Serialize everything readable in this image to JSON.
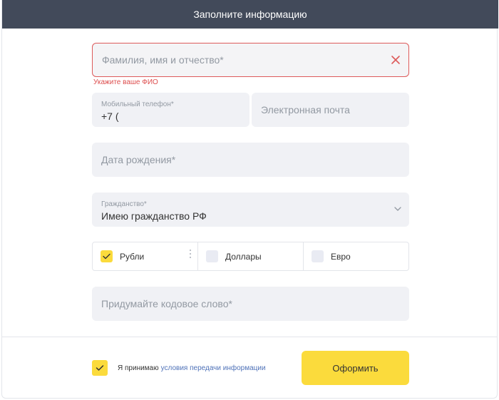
{
  "header": {
    "title": "Заполните информацию"
  },
  "fio": {
    "placeholder": "Фамилия, имя и отчество*",
    "error": "Укажите ваше ФИО"
  },
  "phone": {
    "label": "Мобильный телефон*",
    "value": "+7 ("
  },
  "email": {
    "placeholder": "Электронная почта"
  },
  "birthdate": {
    "placeholder": "Дата рождения*"
  },
  "citizenship": {
    "label": "Гражданство*",
    "value": "Имею гражданство РФ"
  },
  "currencies": [
    {
      "label": "Рубли",
      "checked": true
    },
    {
      "label": "Доллары",
      "checked": false
    },
    {
      "label": "Евро",
      "checked": false
    }
  ],
  "codeword": {
    "placeholder": "Придумайте кодовое слово*"
  },
  "consent": {
    "text": "Я принимаю",
    "link": "условия передачи информации",
    "checked": true
  },
  "submit": {
    "label": "Оформить"
  },
  "colors": {
    "header_bg": "#424a5a",
    "accent": "#fbdb3c",
    "error": "#dd4d4d",
    "link": "#4f72b8",
    "field_bg": "#f0f1f5"
  },
  "icons": {
    "clear": "close-icon",
    "select": "chevron-down-icon",
    "check": "check-icon",
    "menu": "dots-vertical-icon"
  }
}
